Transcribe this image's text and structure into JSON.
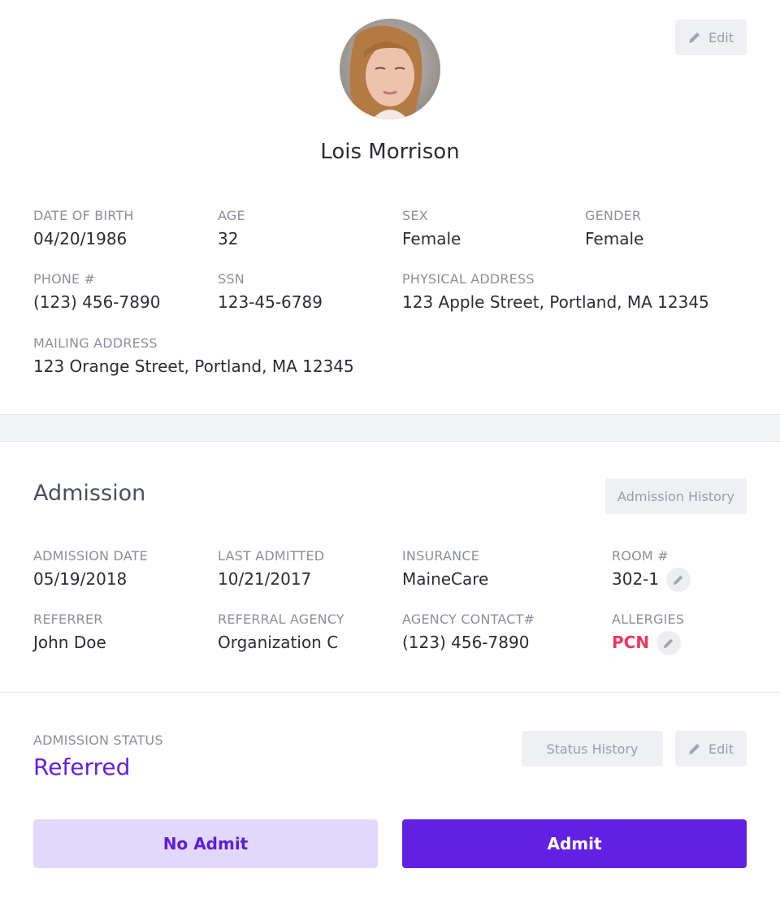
{
  "profile": {
    "name": "Lois Morrison",
    "edit_label": "Edit",
    "fields": {
      "dob": {
        "label": "DATE OF BIRTH",
        "value": "04/20/1986"
      },
      "age": {
        "label": "AGE",
        "value": "32"
      },
      "sex": {
        "label": "SEX",
        "value": "Female"
      },
      "gender": {
        "label": "GENDER",
        "value": "Female"
      },
      "phone": {
        "label": "PHONE #",
        "value": "(123) 456-7890"
      },
      "ssn": {
        "label": "SSN",
        "value": "123-45-6789"
      },
      "physical_address": {
        "label": "PHYSICAL ADDRESS",
        "value": "123 Apple Street, Portland, MA 12345"
      },
      "mailing_address": {
        "label": "MAILING ADDRESS",
        "value": "123 Orange Street, Portland, MA 12345"
      }
    }
  },
  "admission": {
    "title": "Admission",
    "history_label": "Admission History",
    "fields": {
      "admission_date": {
        "label": "ADMISSION DATE",
        "value": "05/19/2018"
      },
      "last_admitted": {
        "label": "LAST ADMITTED",
        "value": "10/21/2017"
      },
      "insurance": {
        "label": "INSURANCE",
        "value": "MaineCare"
      },
      "room": {
        "label": "ROOM #",
        "value": "302-1"
      },
      "referrer": {
        "label": "REFERRER",
        "value": "John Doe"
      },
      "referral_agency": {
        "label": "REFERRAL AGENCY",
        "value": "Organization C"
      },
      "agency_contact": {
        "label": "AGENCY CONTACT#",
        "value": "(123) 456-7890"
      },
      "allergies": {
        "label": "ALLERGIES",
        "value": "PCN"
      }
    }
  },
  "status": {
    "label": "ADMISSION STATUS",
    "value": "Referred",
    "history_label": "Status History",
    "edit_label": "Edit"
  },
  "actions": {
    "no_admit_label": "No Admit",
    "admit_label": "Admit"
  },
  "colors": {
    "accent": "#6320e5",
    "accent_light": "#e2d8fb",
    "allergy": "#f0365a",
    "muted": "#8c8f99"
  }
}
